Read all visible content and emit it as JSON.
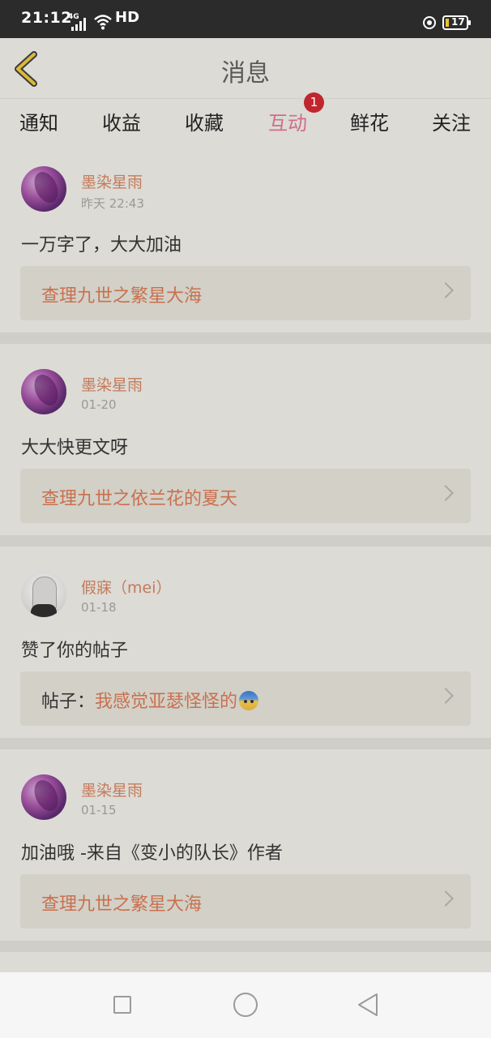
{
  "status_bar": {
    "time": "21:12",
    "network": "4G",
    "hd": "HD",
    "battery": "17"
  },
  "header": {
    "title": "消息"
  },
  "tabs": [
    {
      "label": "通知"
    },
    {
      "label": "收益"
    },
    {
      "label": "收藏"
    },
    {
      "label": "互动",
      "badge": "1",
      "active": true
    },
    {
      "label": "鲜花"
    },
    {
      "label": "关注"
    }
  ],
  "messages": [
    {
      "user": "墨染星雨",
      "time": "昨天 22:43",
      "text": "一万字了，大大加油",
      "ref": "查理九世之繁星大海",
      "avatar": "purple-avatar"
    },
    {
      "user": "墨染星雨",
      "time": "01-20",
      "text": "大大快更文呀",
      "ref": "查理九世之依兰花的夏天",
      "avatar": "purple-avatar"
    },
    {
      "user": "假寐（mei）",
      "time": "01-18",
      "text": "赞了你的帖子",
      "ref_prefix": "帖子：",
      "ref": "我感觉亚瑟怪怪的",
      "ref_icon": "anxious-face-emoji",
      "avatar": "girl-avatar"
    },
    {
      "user": "墨染星雨",
      "time": "01-15",
      "text": "加油哦 -来自《变小的队长》作者",
      "ref": "查理九世之繁星大海",
      "avatar": "purple-avatar"
    }
  ],
  "colors": {
    "accent": "#cf6d8a",
    "username": "#c57a5a",
    "badge": "#c0262e"
  }
}
